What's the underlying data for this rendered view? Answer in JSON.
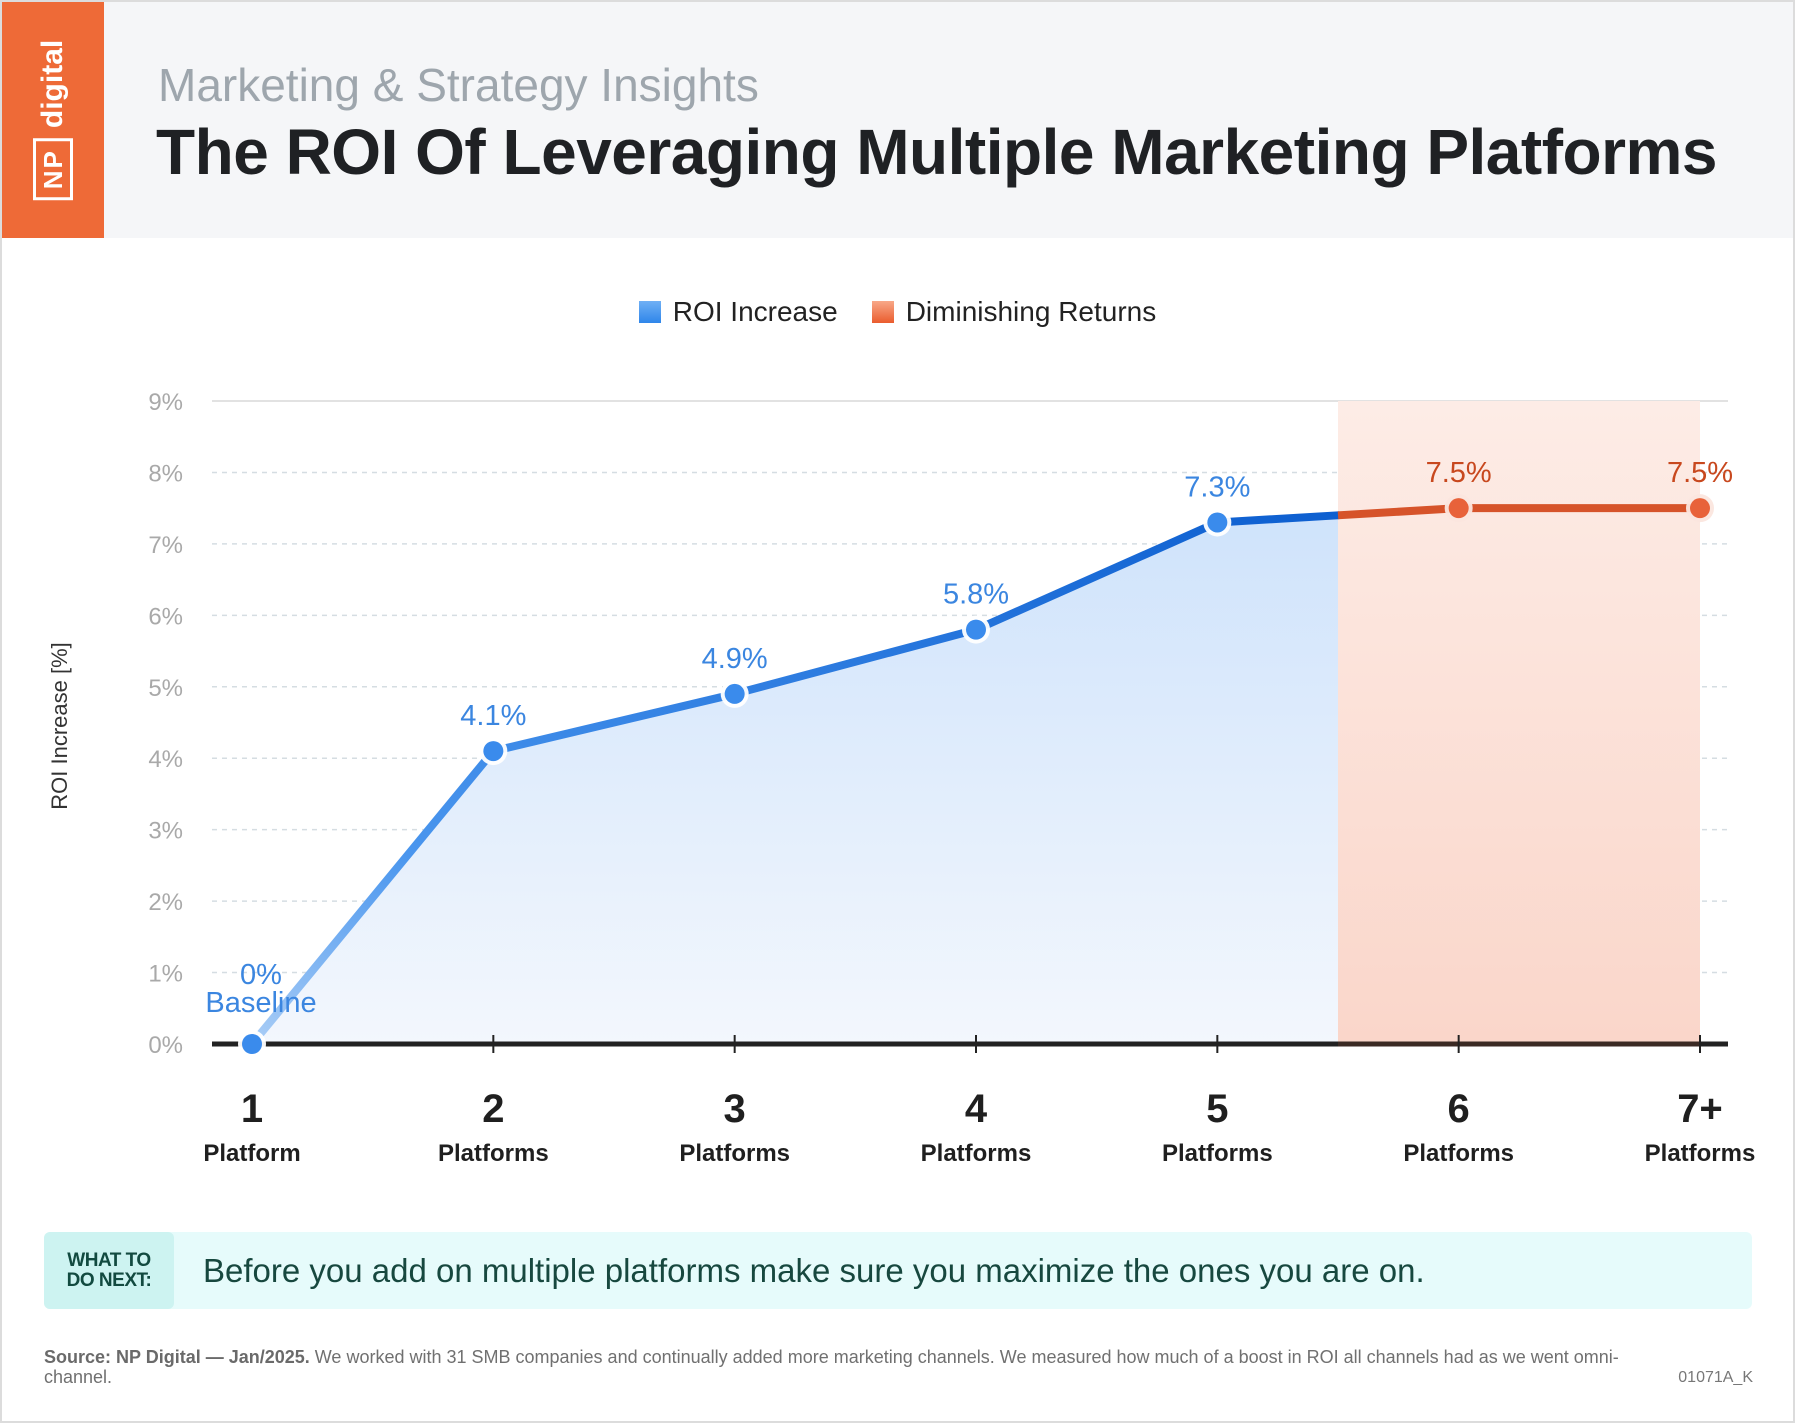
{
  "header": {
    "brand_np": "NP",
    "brand_digital": "digital",
    "subtitle": "Marketing & Strategy Insights",
    "title": "The ROI Of Leveraging Multiple Marketing Platforms"
  },
  "legend": [
    {
      "label": "ROI Increase",
      "color": "#2f86ea"
    },
    {
      "label": "Diminishing Returns",
      "color": "#ea5c2e"
    }
  ],
  "chart_data": {
    "type": "line",
    "title": "The ROI Of Leveraging Multiple Marketing Platforms",
    "xlabel": "",
    "ylabel": "ROI Increase [%]",
    "ylim": [
      0,
      9
    ],
    "y_ticks": [
      "0%",
      "1%",
      "2%",
      "3%",
      "4%",
      "5%",
      "6%",
      "7%",
      "8%",
      "9%"
    ],
    "grid": true,
    "legend_position": "top-center",
    "categories": [
      {
        "number": "1",
        "unit": "Platform"
      },
      {
        "number": "2",
        "unit": "Platforms"
      },
      {
        "number": "3",
        "unit": "Platforms"
      },
      {
        "number": "4",
        "unit": "Platforms"
      },
      {
        "number": "5",
        "unit": "Platforms"
      },
      {
        "number": "6",
        "unit": "Platforms"
      },
      {
        "number": "7+",
        "unit": "Platforms"
      }
    ],
    "series": [
      {
        "name": "ROI Increase",
        "color": "#2f86ea",
        "values": [
          0,
          4.1,
          4.9,
          5.8,
          7.3,
          null,
          null
        ],
        "labels": [
          "0%",
          "4.1%",
          "4.9%",
          "5.8%",
          "7.3%",
          null,
          null
        ]
      },
      {
        "name": "Diminishing Returns",
        "color": "#d6532a",
        "values": [
          null,
          null,
          null,
          null,
          null,
          7.5,
          7.5
        ],
        "labels": [
          null,
          null,
          null,
          null,
          null,
          "7.5%",
          "7.5%"
        ]
      }
    ],
    "annotations": [
      {
        "category_index": 0,
        "text": "Baseline"
      }
    ],
    "shaded_region": {
      "label": "Diminishing Returns",
      "from_category": 4.5,
      "to_category": 6
    }
  },
  "callout": {
    "label_line1": "WHAT TO",
    "label_line2": "DO NEXT:",
    "text": "Before you add on multiple platforms make sure you maximize the ones you are on."
  },
  "footer": {
    "source_label": "Source:  NP Digital — Jan/2025.",
    "source_text": " We worked with 31 SMB companies and continually added more marketing channels. We measured how much of a boost in ROI all channels had as we went omni-channel.",
    "code": "01071A_K"
  }
}
